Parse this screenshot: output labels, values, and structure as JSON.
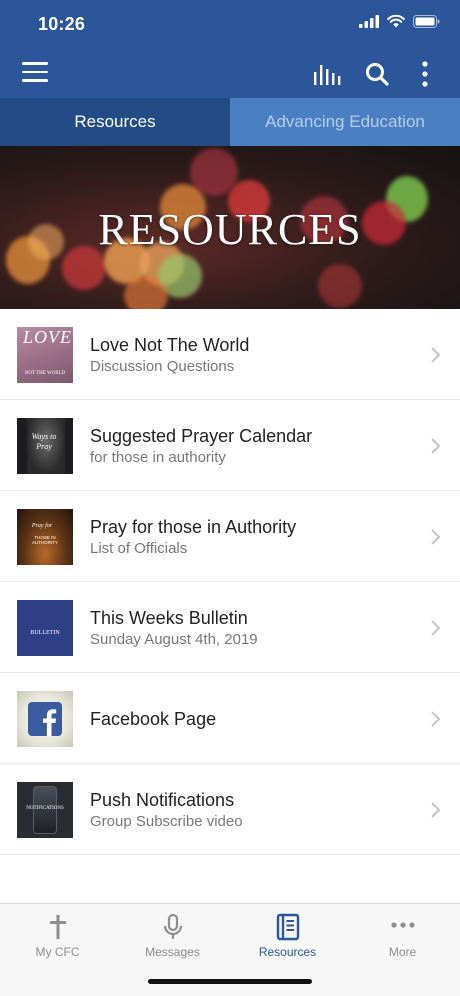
{
  "status_bar": {
    "time": "10:26"
  },
  "app_bar": {
    "menu_icon": "hamburger-menu-icon",
    "chart_icon": "bar-chart-icon",
    "search_icon": "search-icon",
    "more_icon": "more-vertical-icon",
    "color": "#2b569a"
  },
  "tabs": [
    {
      "label": "Resources",
      "active": true
    },
    {
      "label": "Advancing Education",
      "active": false
    }
  ],
  "hero": {
    "title": "RESOURCES"
  },
  "list": [
    {
      "title": "Love Not The World",
      "subtitle": "Discussion Questions",
      "thumb_text_1": "LOVE",
      "thumb_text_2": "NOT THE WORLD"
    },
    {
      "title": "Suggested Prayer Calendar",
      "subtitle": "for those in authority",
      "thumb_text_1": "Ways to Pray"
    },
    {
      "title": "Pray for those in Authority",
      "subtitle": "List of Officials",
      "thumb_text_1": "Pray for",
      "thumb_text_2": "THOSE IN AUTHORITY"
    },
    {
      "title": "This Weeks Bulletin",
      "subtitle": "Sunday August 4th, 2019",
      "thumb_text_1": "BULLETIN"
    },
    {
      "title": "Facebook Page",
      "subtitle": "",
      "thumb_icon": "facebook-icon"
    },
    {
      "title": "Push Notifications",
      "subtitle": "Group Subscribe video",
      "thumb_text_1": "NOTIFICATIONS"
    }
  ],
  "bottom_nav": [
    {
      "label": "My CFC",
      "icon": "cross-icon",
      "active": false
    },
    {
      "label": "Messages",
      "icon": "microphone-icon",
      "active": false
    },
    {
      "label": "Resources",
      "icon": "book-icon",
      "active": true
    },
    {
      "label": "More",
      "icon": "more-horizontal-icon",
      "active": false
    }
  ],
  "colors": {
    "accent": "#2b569a",
    "tab_active": "#234b85",
    "tab_inactive": "#4b7fc4"
  }
}
